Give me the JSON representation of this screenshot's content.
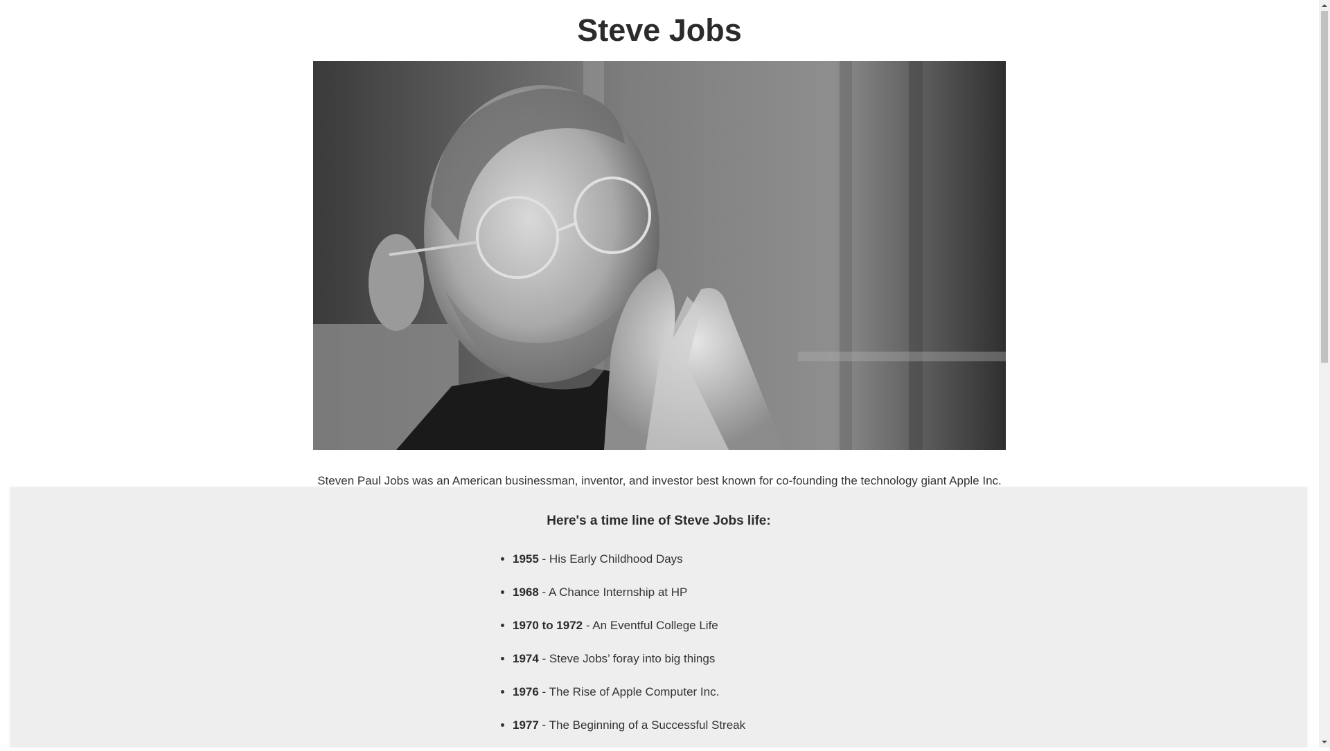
{
  "page": {
    "title": "Steve Jobs",
    "portrait_alt": "Black and white portrait of Steve Jobs",
    "caption": "Steven Paul Jobs was an American businessman, inventor, and investor best known for co-founding the technology giant Apple Inc."
  },
  "timeline": {
    "heading": "Here's a time line of Steve Jobs life:",
    "items": [
      {
        "year": "1955",
        "text": " - His Early Childhood Days"
      },
      {
        "year": "1968",
        "text": " - A Chance Internship at HP"
      },
      {
        "year": "1970 to 1972",
        "text": " - An Eventful College Life"
      },
      {
        "year": "1974",
        "text": " - Steve Jobs’ foray into big things"
      },
      {
        "year": "1976",
        "text": " - The Rise of Apple Computer Inc."
      },
      {
        "year": "1977",
        "text": " - The Beginning of a Successful Streak"
      }
    ]
  },
  "icons": {
    "scroll_up": "triangle-up-icon",
    "scroll_down": "triangle-down-icon"
  }
}
